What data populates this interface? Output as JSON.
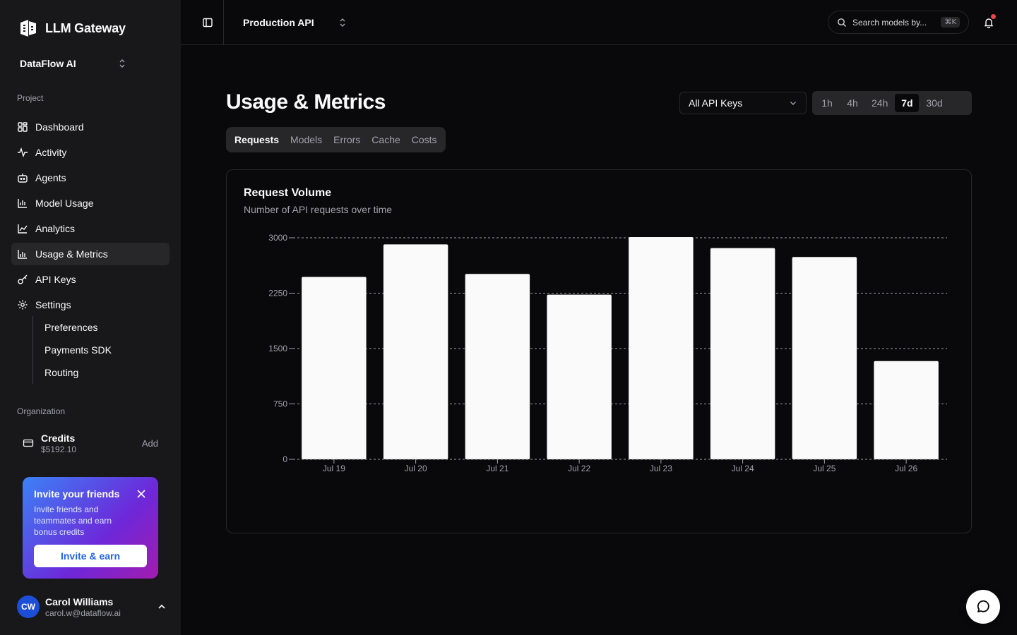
{
  "brand": {
    "name": "LLM Gateway"
  },
  "org_switcher": {
    "label": "DataFlow AI"
  },
  "sidebar": {
    "project_label": "Project",
    "items": [
      {
        "label": "Dashboard",
        "icon": "grid-icon"
      },
      {
        "label": "Activity",
        "icon": "activity-icon"
      },
      {
        "label": "Agents",
        "icon": "bot-icon"
      },
      {
        "label": "Model Usage",
        "icon": "bar-chart-icon"
      },
      {
        "label": "Analytics",
        "icon": "line-chart-icon"
      },
      {
        "label": "Usage & Metrics",
        "icon": "bar-chart-icon"
      },
      {
        "label": "API Keys",
        "icon": "key-icon"
      },
      {
        "label": "Settings",
        "icon": "gear-icon"
      }
    ],
    "active": "Usage & Metrics",
    "settings_sub": [
      "Preferences",
      "Payments SDK",
      "Routing"
    ],
    "org_label": "Organization",
    "credits": {
      "title": "Credits",
      "value": "$5192.10",
      "action": "Add"
    }
  },
  "invite": {
    "title": "Invite your friends",
    "description": "Invite friends and teammates and earn bonus credits",
    "button": "Invite & earn"
  },
  "user": {
    "initials": "CW",
    "name": "Carol Williams",
    "email": "carol.w@dataflow.ai"
  },
  "topbar": {
    "project": "Production API",
    "search_placeholder": "Search models by...",
    "search_shortcut": "⌘K"
  },
  "page": {
    "title": "Usage & Metrics",
    "api_key_filter": "All API Keys",
    "ranges": [
      "1h",
      "4h",
      "24h",
      "7d",
      "30d"
    ],
    "active_range": "7d",
    "tabs": [
      "Requests",
      "Models",
      "Errors",
      "Cache",
      "Costs"
    ],
    "active_tab": "Requests"
  },
  "colors": {
    "accent_blue": "#2563eb",
    "bar": "#fafafa",
    "notification": "#ef4444"
  },
  "chart_data": {
    "type": "bar",
    "title": "Request Volume",
    "subtitle": "Number of API requests over time",
    "categories": [
      "Jul 19",
      "Jul 20",
      "Jul 21",
      "Jul 22",
      "Jul 23",
      "Jul 24",
      "Jul 25",
      "Jul 26"
    ],
    "values": [
      2470,
      2910,
      2510,
      2230,
      3010,
      2860,
      2740,
      1330
    ],
    "yticks": [
      0,
      750,
      1500,
      2250,
      3000
    ],
    "ylim": [
      0,
      3000
    ],
    "grid": true
  }
}
